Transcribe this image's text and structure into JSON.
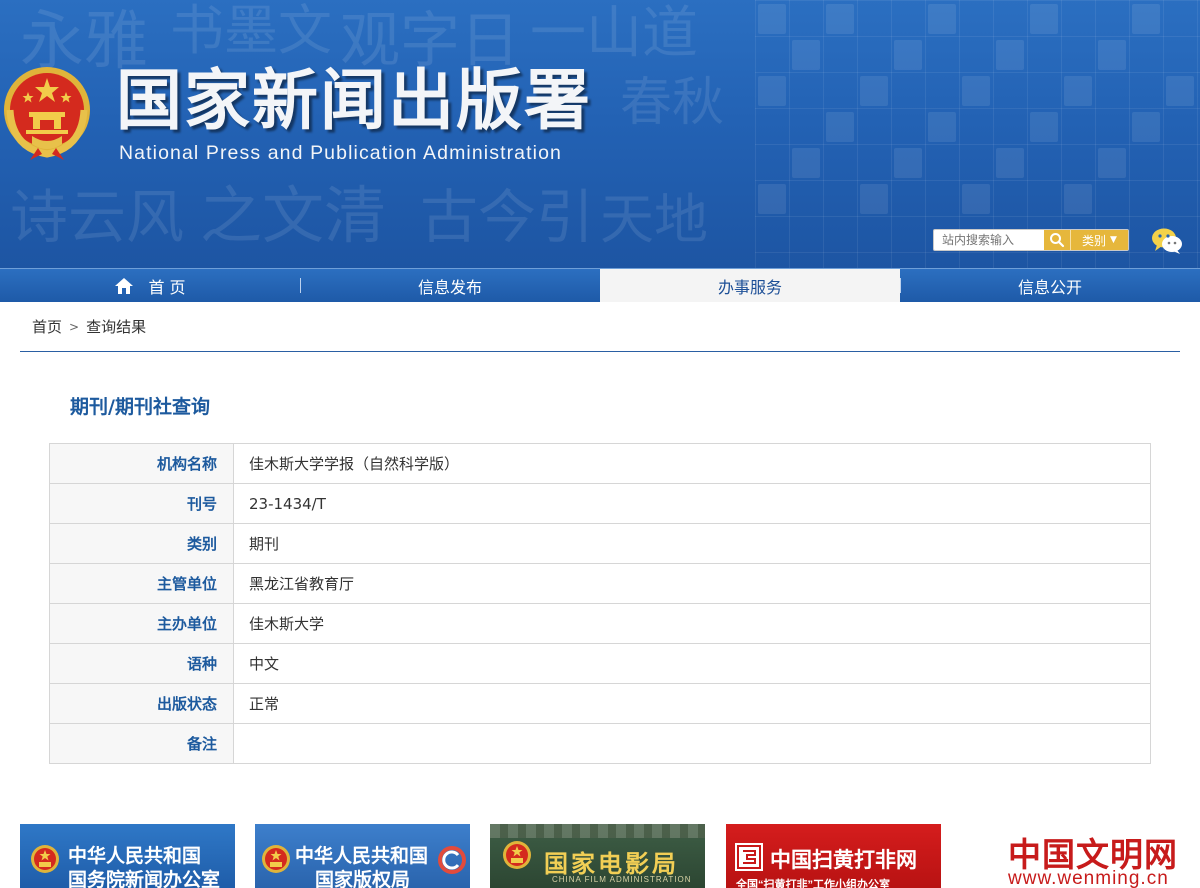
{
  "header": {
    "title": "国家新闻出版署",
    "subtitle": "National  Press and Publication Administration",
    "search_placeholder": "站内搜索输入",
    "category_label": "类别"
  },
  "nav": {
    "items": [
      {
        "label": "首 页"
      },
      {
        "label": "信息发布"
      },
      {
        "label": "办事服务"
      },
      {
        "label": "信息公开"
      }
    ]
  },
  "breadcrumb": {
    "home": "首页",
    "separator": ">",
    "current": "查询结果"
  },
  "section": {
    "title": "期刊/期刊社查询"
  },
  "table": {
    "rows": [
      {
        "label": "机构名称",
        "value": "佳木斯大学学报（自然科学版）"
      },
      {
        "label": "刊号",
        "value": "23-1434/T"
      },
      {
        "label": "类别",
        "value": "期刊"
      },
      {
        "label": "主管单位",
        "value": "黑龙江省教育厅"
      },
      {
        "label": "主办单位",
        "value": "佳木斯大学"
      },
      {
        "label": "语种",
        "value": "中文"
      },
      {
        "label": "出版状态",
        "value": "正常"
      },
      {
        "label": "备注",
        "value": ""
      }
    ]
  },
  "banners": {
    "b1_line1": "中华人民共和国",
    "b1_line2": "国务院新闻办公室",
    "b2_line1": "中华人民共和国",
    "b2_line2": "国家版权局",
    "b3_title": "国家电影局",
    "b3_sub": "CHINA FILM ADMINISTRATION",
    "b4_title": "中国扫黄打非网",
    "b4_sub": "全国“扫黄打非”工作小组办公室",
    "b5_title": "中国文明网",
    "b5_url": "www.wenming.cn"
  },
  "colors": {
    "header_blue": "#2362b4",
    "label_blue": "#1d5a9e",
    "search_gold": "#e6b73c",
    "active_tab_bg": "#f4f4f4"
  },
  "icons": [
    "national-emblem-icon",
    "search-icon",
    "wechat-icon",
    "home-icon"
  ]
}
